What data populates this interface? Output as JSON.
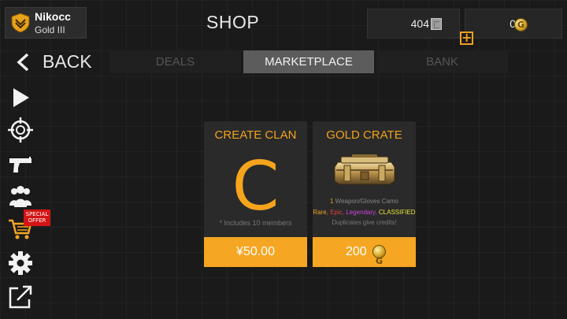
{
  "profile": {
    "name": "Nikocc",
    "rank": "Gold III"
  },
  "header": {
    "title": "SHOP"
  },
  "currency": {
    "credits": "404",
    "gold": "0",
    "add_label": "+"
  },
  "nav": {
    "back_label": "BACK",
    "tabs": [
      {
        "label": "DEALS",
        "active": false
      },
      {
        "label": "MARKETPLACE",
        "active": true
      },
      {
        "label": "BANK",
        "active": false
      }
    ]
  },
  "sidebar": {
    "icons": [
      "play-icon",
      "crosshair-icon",
      "pistol-icon",
      "users-icon",
      "cart-icon",
      "gear-icon",
      "external-link-icon"
    ],
    "special_offer": "SPECIAL OFFER"
  },
  "cards": {
    "clan": {
      "title": "CREATE CLAN",
      "letter": "C",
      "note": "* Includes 10 members",
      "price": "¥50.00"
    },
    "crate": {
      "title": "GOLD CRATE",
      "count": "1",
      "line1": "Weapon/Gloves Camo",
      "rare": "Rare,",
      "epic": "Epic,",
      "legendary": "Legendary,",
      "classified": "CLASSIFIED",
      "line3": "Duplicates give credits!",
      "price": "200"
    }
  },
  "colors": {
    "accent": "#f5a623",
    "title_orange": "#f0a21e",
    "rare": "#f0a21e",
    "epic": "#e04040",
    "legendary": "#cc44dd",
    "classified": "#e8e43a",
    "special_badge": "#d41414"
  }
}
